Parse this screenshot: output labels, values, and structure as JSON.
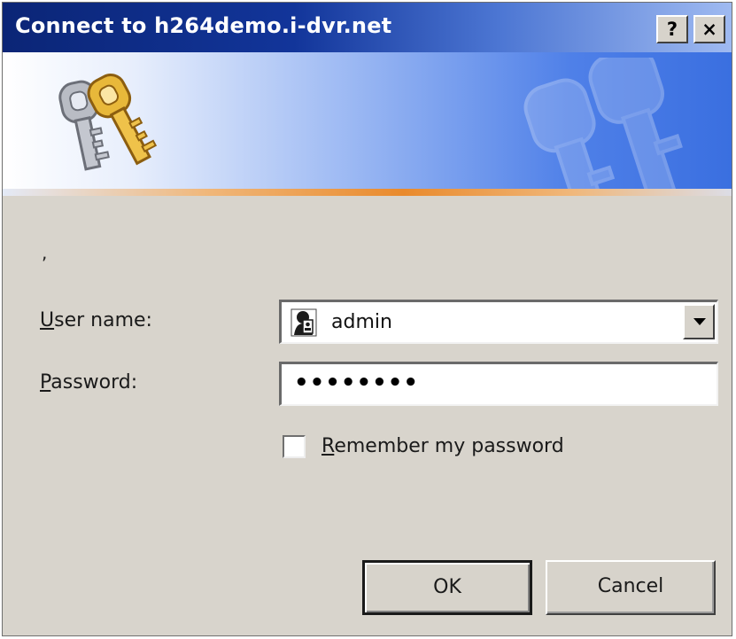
{
  "dialog": {
    "title": "Connect to h264demo.i-dvr.net",
    "help_label": "?",
    "close_label": "×"
  },
  "banner": {
    "icon": "keys-icon",
    "watermark": "keys-watermark-icon"
  },
  "message": ",",
  "form": {
    "username_label_first": "U",
    "username_label_rest": "ser name:",
    "username_value": "admin",
    "username_icon": "user-icon",
    "password_label_first": "P",
    "password_label_rest": "assword:",
    "password_value": "••••••••",
    "remember_label_first": "R",
    "remember_label_rest": "emember my password",
    "remember_checked": false
  },
  "buttons": {
    "ok_label": "OK",
    "cancel_label": "Cancel"
  },
  "colors": {
    "title_gradient_start": "#0b2576",
    "title_gradient_end": "#9fbaf1",
    "dialog_face": "#d8d4cc",
    "banner_accent": "#e98a2c"
  }
}
